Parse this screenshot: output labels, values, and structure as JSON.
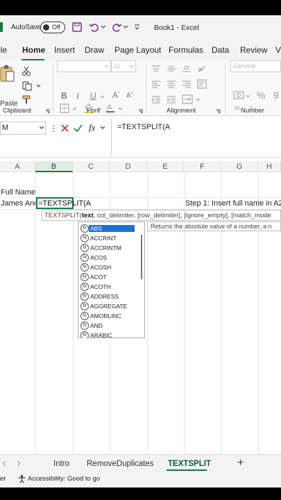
{
  "titlebar": {
    "autosave_label": "AutoSave",
    "autosave_state": "Off",
    "doc_title": "Book1 - Excel"
  },
  "menu": {
    "tabs": [
      "ile",
      "Home",
      "Insert",
      "Draw",
      "Page Layout",
      "Formulas",
      "Data",
      "Review",
      "V"
    ],
    "active": "Home"
  },
  "ribbon": {
    "groups": [
      "Clipboard",
      "Font",
      "Alignment",
      "Number"
    ],
    "paste_label": "Paste",
    "font_size": "11",
    "number_format": "General",
    "percent": "%",
    "comma": "9"
  },
  "formula_bar": {
    "name_box": "M",
    "fx_label": "fx",
    "formula": "=TEXTSPLIT(A"
  },
  "grid": {
    "columns": [
      "A",
      "B",
      "C",
      "D",
      "E",
      "F",
      "G",
      "H"
    ],
    "selected_column": "B",
    "a1": "Full Name",
    "a2": "James And",
    "b2_editing": "=TEXTSPLIT(A",
    "step_note": "Step 1: Insert full name in A2."
  },
  "tooltip": {
    "fn": "TEXTSPLIT(",
    "arg": "text",
    "rest": ", col_delimiter, [row_delimiter], [ignore_empty], [match_mode"
  },
  "autocomplete": {
    "items": [
      "ABS",
      "ACCRINT",
      "ACCRINTM",
      "ACOS",
      "ACOSH",
      "ACOT",
      "ACOTH",
      "ADDRESS",
      "AGGREGATE",
      "AMORLINC",
      "AND",
      "ARABIC"
    ],
    "selected_index": 0,
    "description": "Returns the absolute value of a number, a n"
  },
  "sheets": {
    "tabs": [
      "Intro",
      "RemoveDuplicates",
      "TEXTSPLIT"
    ],
    "active": "TEXTSPLIT",
    "add": "+"
  },
  "status": {
    "left": "er",
    "accessibility": "Accessibility: Good to go"
  },
  "colors": {
    "accent": "#107c41",
    "selection": "#1f6fd1"
  }
}
